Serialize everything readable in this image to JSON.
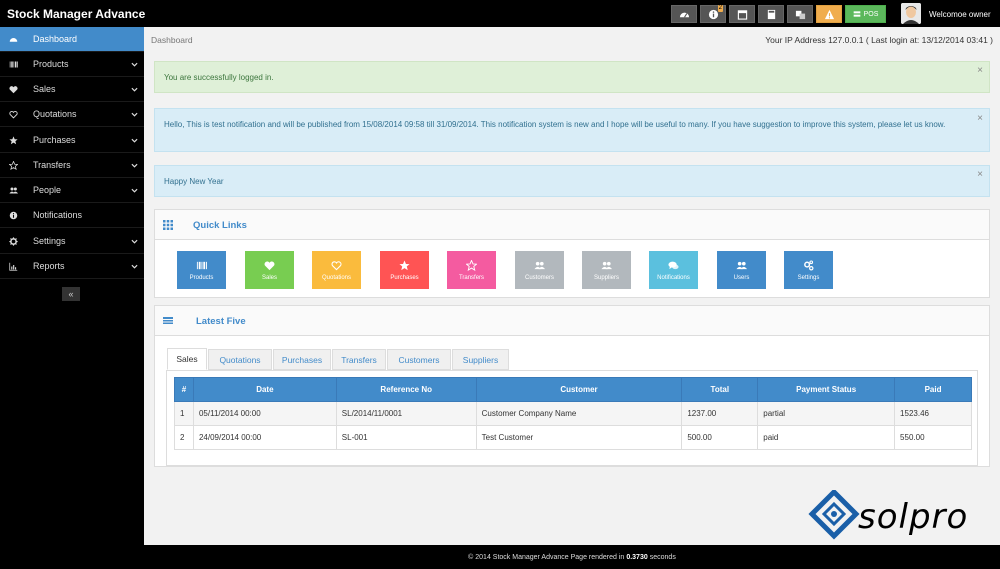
{
  "app": {
    "title": "Stock Manager Advance"
  },
  "topbar": {
    "alerts_badge": "2",
    "pos_label": "POS",
    "welcome": "Welcomoe owner",
    "icons": [
      "dashboard-icon",
      "info-icon",
      "calendar-icon",
      "calculator-icon",
      "language-icon",
      "warning-icon"
    ]
  },
  "sidebar": {
    "items": [
      {
        "label": "Dashboard",
        "icon": "dashboard-icon",
        "caret": false,
        "active": true
      },
      {
        "label": "Products",
        "icon": "barcode-icon",
        "caret": true
      },
      {
        "label": "Sales",
        "icon": "heart-icon",
        "caret": true
      },
      {
        "label": "Quotations",
        "icon": "heart-outline-icon",
        "caret": true
      },
      {
        "label": "Purchases",
        "icon": "star-icon",
        "caret": true
      },
      {
        "label": "Transfers",
        "icon": "star-outline-icon",
        "caret": true
      },
      {
        "label": "People",
        "icon": "users-icon",
        "caret": true
      },
      {
        "label": "Notifications",
        "icon": "info-icon",
        "caret": false
      },
      {
        "label": "Settings",
        "icon": "gear-icon",
        "caret": true
      },
      {
        "label": "Reports",
        "icon": "bar-chart-icon",
        "caret": true
      }
    ],
    "collapse_label": "«"
  },
  "main": {
    "breadcrumb": "Dashboard",
    "ip_info": "Your IP Address 127.0.0.1 ( Last login at: 13/12/2014 03:41 )",
    "alerts": [
      "You are successfully logged in.",
      "Hello, This is test notification and will be published from 15/08/2014 09:58 till 31/09/2014. This notification system is new and I hope will be useful to many. If you have suggestion to improve this system, please let us know.",
      "Happy New Year"
    ],
    "close_label": "×"
  },
  "quick_links": {
    "title": "Quick Links",
    "items": [
      {
        "label": "Products",
        "color": "#428bca",
        "icon": "barcode-icon"
      },
      {
        "label": "Sales",
        "color": "#78cd51",
        "icon": "heart-icon"
      },
      {
        "label": "Quotations",
        "color": "#fabb3d",
        "icon": "heart-outline-icon"
      },
      {
        "label": "Purchases",
        "color": "#ff5454",
        "icon": "star-icon"
      },
      {
        "label": "Transfers",
        "color": "#f45ba0",
        "icon": "star-outline-icon"
      },
      {
        "label": "Customers",
        "color": "#b2b8bd",
        "icon": "users-icon"
      },
      {
        "label": "Suppliers",
        "color": "#b2b8bd",
        "icon": "users-icon"
      },
      {
        "label": "Notifications",
        "color": "#5bc0de",
        "icon": "comments-icon"
      },
      {
        "label": "Users",
        "color": "#428bca",
        "icon": "users-icon"
      },
      {
        "label": "Settings",
        "color": "#428bca",
        "icon": "gears-icon"
      }
    ]
  },
  "latest_five": {
    "title": "Latest Five",
    "tabs": [
      "Sales",
      "Quotations",
      "Purchases",
      "Transfers",
      "Customers",
      "Suppliers"
    ],
    "columns": [
      "#",
      "Date",
      "Reference No",
      "Customer",
      "Total",
      "Payment Status",
      "Paid"
    ],
    "rows": [
      [
        "1",
        "05/11/2014 00:00",
        "SL/2014/11/0001",
        "Customer Company Name",
        "1237.00",
        "partial",
        "1523.46"
      ],
      [
        "2",
        "24/09/2014 00:00",
        "SL-001",
        "Test Customer",
        "500.00",
        "paid",
        "550.00"
      ]
    ]
  },
  "footer": {
    "prefix": "© 2014 Stock Manager Advance Page rendered in",
    "time": "0.3730",
    "suffix": "seconds"
  },
  "watermark": {
    "text": "solpro"
  },
  "colors": {
    "accent": "#428bca",
    "success": "#dff0d8",
    "info": "#d9edf7",
    "warning": "#f0ad4e",
    "pos": "#5cb85c"
  }
}
